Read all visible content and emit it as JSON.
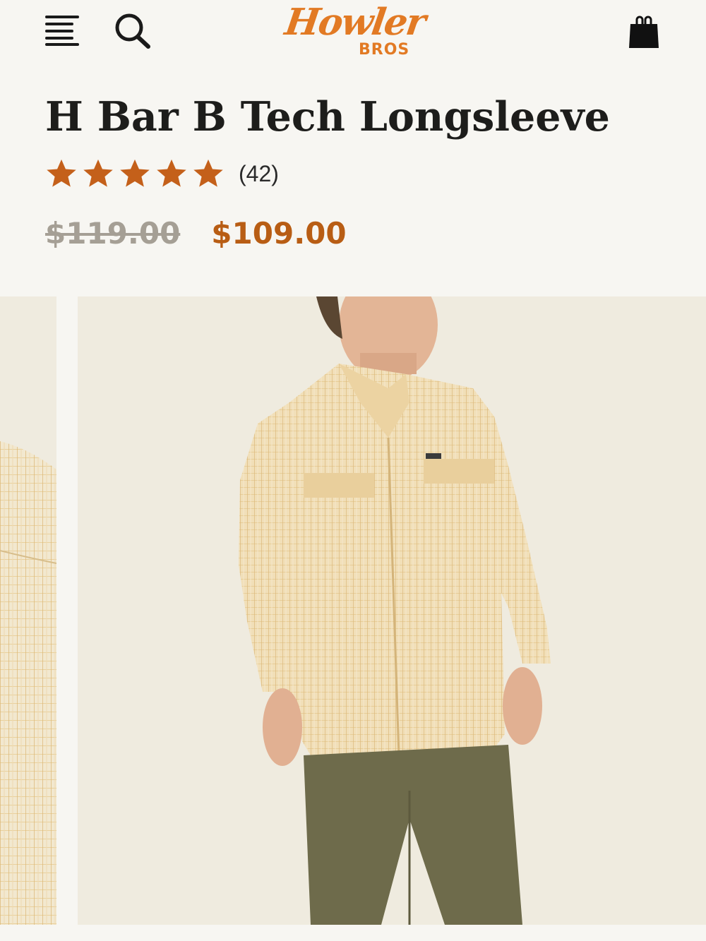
{
  "header": {
    "logo_script": "Howler",
    "logo_sub": "BROS",
    "menu_icon": "hamburger-menu-icon",
    "search_icon": "search-icon",
    "cart_icon": "shopping-bag-icon"
  },
  "product": {
    "title": "H Bar B Tech Longsleeve",
    "rating": 5,
    "review_count": "(42)",
    "original_price": "$119.00",
    "sale_price": "$109.00"
  },
  "colors": {
    "brand_orange": "#e27a24",
    "sale_price": "#b85d14",
    "star": "#c4601a",
    "strike_price": "#a59f95",
    "title": "#1d1d1b",
    "image_bg": "#efebdf"
  }
}
